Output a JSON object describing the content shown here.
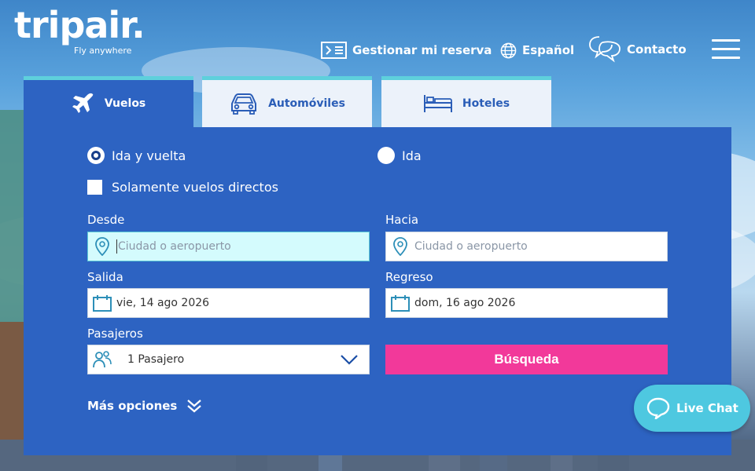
{
  "brand": {
    "logo": "tripair.",
    "tagline": "Fly anywhere"
  },
  "header": {
    "manage_booking": "Gestionar mi reserva",
    "language": "Español",
    "contact": "Contacto"
  },
  "tabs": [
    {
      "label": "Vuelos",
      "icon": "airplane-icon",
      "active": true
    },
    {
      "label": "Automóviles",
      "icon": "car-icon",
      "active": false
    },
    {
      "label": "Hoteles",
      "icon": "bed-icon",
      "active": false
    }
  ],
  "trip_type": {
    "round_trip": "Ida y vuelta",
    "one_way": "Ida",
    "selected": "round_trip"
  },
  "direct_only": {
    "label": "Solamente vuelos directos",
    "checked": false
  },
  "from": {
    "label": "Desde",
    "placeholder": "Ciudad o aeropuerto",
    "value": ""
  },
  "to": {
    "label": "Hacia",
    "placeholder": "Ciudad o aeropuerto",
    "value": ""
  },
  "departure": {
    "label": "Salida",
    "value": "vie, 14 ago 2026"
  },
  "return": {
    "label": "Regreso",
    "value": "dom, 16 ago 2026"
  },
  "passengers": {
    "label": "Pasajeros",
    "value": "1 Pasajero"
  },
  "search_button": "Búsqueda",
  "more_options": "Más opciones",
  "live_chat": "Live Chat",
  "colors": {
    "panel": "#2d63c2",
    "tab_accent": "#5ed0dc",
    "search_button": "#f2399a",
    "focused_field": "#d4fbfd",
    "live_chat": "#4ec8e0"
  }
}
